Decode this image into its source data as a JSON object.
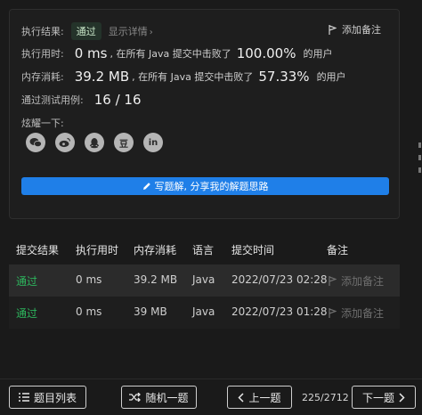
{
  "result": {
    "label": "执行结果:",
    "status": "通过",
    "detail_link": "显示详情",
    "add_note": "添加备注"
  },
  "runtime": {
    "label": "执行用时:",
    "value": "0 ms",
    "prefix": ", 在所有 Java 提交中击败了",
    "percent": "100.00%",
    "suffix": "的用户"
  },
  "memory": {
    "label": "内存消耗:",
    "value": "39.2 MB",
    "prefix": ", 在所有 Java 提交中击败了",
    "percent": "57.33%",
    "suffix": "的用户"
  },
  "tests": {
    "label": "通过测试用例:",
    "value": "16 / 16"
  },
  "share": {
    "label": "炫耀一下:",
    "icons": [
      "wechat-icon",
      "weibo-icon",
      "qq-icon",
      "douban-icon",
      "linkedin-icon"
    ],
    "douban_glyph": "豆",
    "linkedin_glyph": "in"
  },
  "write_solution": "写题解, 分享我的解题思路",
  "table": {
    "headers": [
      "提交结果",
      "执行用时",
      "内存消耗",
      "语言",
      "提交时间",
      "备注"
    ],
    "rows": [
      {
        "status": "通过",
        "runtime": "0 ms",
        "memory": "39.2 MB",
        "lang": "Java",
        "time": "2022/07/23 02:28",
        "note": "添加备注"
      },
      {
        "status": "通过",
        "runtime": "0 ms",
        "memory": "39 MB",
        "lang": "Java",
        "time": "2022/07/23 01:28",
        "note": "添加备注"
      }
    ]
  },
  "footer": {
    "problem_list": "题目列表",
    "random": "随机一题",
    "prev": "上一题",
    "page": "225/2712",
    "next": "下一题"
  },
  "colors": {
    "accent_blue": "#1f7fe8",
    "pass_green": "#2db55d"
  }
}
